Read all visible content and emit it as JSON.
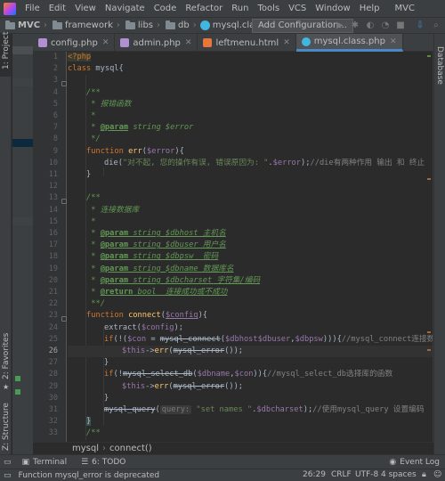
{
  "menu": {
    "items": [
      "File",
      "Edit",
      "View",
      "Navigate",
      "Code",
      "Refactor",
      "Run",
      "Tools",
      "VCS",
      "Window",
      "Help"
    ],
    "project_title": "MVC"
  },
  "nav": {
    "crumbs": [
      "MVC",
      "framework",
      "libs",
      "db",
      "mysql.class.php"
    ],
    "add_config": "Add Configuration..."
  },
  "tabs": [
    {
      "label": "config.php",
      "color": "#b090d0",
      "active": false
    },
    {
      "label": "admin.php",
      "color": "#b090d0",
      "active": false
    },
    {
      "label": "leftmenu.html",
      "color": "#e8753a",
      "active": false
    },
    {
      "label": "mysql.class.php",
      "color": "#40b6e0",
      "active": true
    }
  ],
  "side": {
    "project": "1: Project",
    "favorites": "2: Favorites",
    "structure": "Z: Structure",
    "database": "Database"
  },
  "code": {
    "l1": "<?php",
    "l2a": "class ",
    "l2b": "mysql{",
    "l4": "/**",
    "l5": " * 报错函数",
    "l6": " *",
    "l7a": " * ",
    "l7b": "@param",
    "l7c": " string $error",
    "l8": " */",
    "l9a": "function ",
    "l9b": "err",
    "l9c": "(",
    "l9d": "$error",
    "l9e": "){",
    "l10a": "die(",
    "l10b": "\"对不起, 您的操作有误, 错误原因为: \"",
    "l10c": ".",
    "l10d": "$error",
    "l10e": ");",
    "l10f": "//die有两种作用 输出 和 终止   相",
    "l11": "}",
    "l13": "/**",
    "l14": " * 连接数据库",
    "l15": " *",
    "l16a": " * ",
    "l16b": "@param",
    "l16c": " string $dbhost 主机名",
    "l17a": " * ",
    "l17b": "@param",
    "l17c": " string $dbuser 用户名",
    "l18a": " * ",
    "l18b": "@param",
    "l18c": " string $dbpsw  密码",
    "l19a": " * ",
    "l19b": "@param",
    "l19c": " string $dbname 数据库名",
    "l20a": " * ",
    "l20b": "@param",
    "l20c": " string $dbcharset 字符集/编码",
    "l21a": " * ",
    "l21b": "@return",
    "l21c": " bool  连接成功或不成功",
    "l22": " **/",
    "l23a": "function ",
    "l23b": "connect",
    "l23c": "(",
    "l23d": "$config",
    "l23e": "){",
    "l24a": "extract(",
    "l24b": "$config",
    "l24c": ");",
    "l25a": "if",
    "l25b": "(!(",
    "l25c": "$con",
    "l25d": " = ",
    "l25e": "mysql_connect",
    "l25f": "(",
    "l25g": "$dbhost",
    ",l25h": ",",
    "l25i": "$dbuser",
    "l25j": ",",
    "l25k": "$dbpsw",
    "l25l": "))){",
    "l25m": "//mysql_connect连接数据库函",
    "l26a": "$this",
    "l26b": "->",
    "l26c": "err",
    "l26d": "(",
    "l26e": "mysql_error",
    "l26f": "());",
    "l27": "}",
    "l28a": "if",
    "l28b": "(!",
    "l28c": "mysql_select_db",
    "l28d": "(",
    "l28e": "$dbname",
    "l28f": ",",
    "l28g": "$con",
    "l28h": ")){",
    "l28i": "//mysql_select_db选择库的函数",
    "l29a": "$this",
    "l29b": "->",
    "l29c": "err",
    "l29d": "(",
    "l29e": "mysql_error",
    "l29f": "());",
    "l30": "}",
    "l31a": "mysql_query",
    "l31b": "(",
    "l31c": "query:",
    "l31d": " \"set names \"",
    "l31e": ".",
    "l31f": "$dbcharset",
    "l31g": ");",
    "l31h": "//使用mysql_query 设置编码  格式, m",
    "l32": "}",
    "l33": "/**"
  },
  "breadcrumb_bottom": [
    "mysql",
    "connect()"
  ],
  "tools": {
    "terminal": "Terminal",
    "todo": "6: TODO",
    "event_log": "Event Log"
  },
  "status": {
    "message": "Function mysql_error is deprecated",
    "position": "26:29",
    "line_sep": "CRLF",
    "encoding": "UTF-8",
    "indent": "4 spaces"
  },
  "line_numbers": [
    "1",
    "2",
    "3",
    "4",
    "5",
    "6",
    "7",
    "8",
    "9",
    "10",
    "11",
    "12",
    "13",
    "14",
    "15",
    "16",
    "17",
    "18",
    "19",
    "20",
    "21",
    "22",
    "23",
    "24",
    "25",
    "26",
    "27",
    "28",
    "29",
    "30",
    "31",
    "32",
    "33"
  ]
}
